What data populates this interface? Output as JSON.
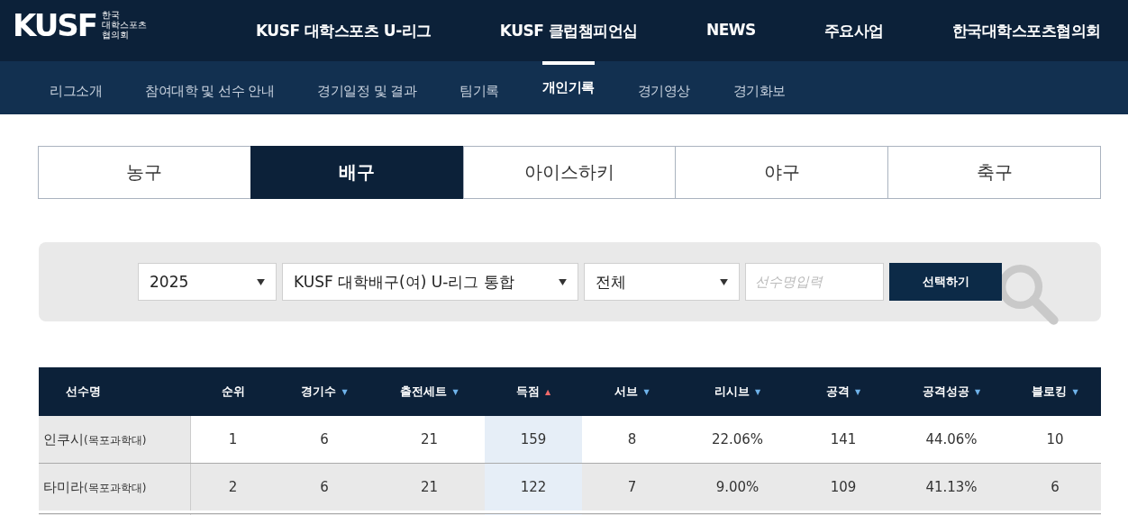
{
  "logo": {
    "mark": "KUSF",
    "lines": [
      "한국",
      "대학스포츠",
      "협의회"
    ]
  },
  "main_nav": [
    "KUSF 대학스포츠 U-리그",
    "KUSF 클럽챔피언십",
    "NEWS",
    "주요사업",
    "한국대학스포츠협의회"
  ],
  "sub_nav": [
    {
      "label": "리그소개",
      "selected": false
    },
    {
      "label": "참여대학 및 선수 안내",
      "selected": false
    },
    {
      "label": "경기일정 및 결과",
      "selected": false
    },
    {
      "label": "팀기록",
      "selected": false
    },
    {
      "label": "개인기록",
      "selected": true
    },
    {
      "label": "경기영상",
      "selected": false
    },
    {
      "label": "경기화보",
      "selected": false
    }
  ],
  "sport_tabs": [
    {
      "label": "농구",
      "selected": false
    },
    {
      "label": "배구",
      "selected": true
    },
    {
      "label": "아이스하키",
      "selected": false
    },
    {
      "label": "야구",
      "selected": false
    },
    {
      "label": "축구",
      "selected": false
    }
  ],
  "filters": {
    "year": "2025",
    "league": "KUSF 대학배구(여) U-리그 통합",
    "group": "전체",
    "search": {
      "placeholder": "선수명입력"
    },
    "button": "선택하기"
  },
  "table": {
    "columns": [
      {
        "label": "선수명"
      },
      {
        "label": "순위"
      },
      {
        "label": "경기수",
        "sorted": false,
        "icon": "▼"
      },
      {
        "label": "출전세트",
        "sorted": false,
        "icon": "▼"
      },
      {
        "label": "득점",
        "sorted": true,
        "icon": "▲"
      },
      {
        "label": "서브",
        "sorted": false,
        "icon": "▼"
      },
      {
        "label": "리시브",
        "sorted": false,
        "icon": "▼"
      },
      {
        "label": "공격",
        "sorted": false,
        "icon": "▼"
      },
      {
        "label": "공격성공",
        "sorted": false,
        "icon": "▼"
      },
      {
        "label": "블로킹",
        "sorted": false,
        "icon": "▼"
      }
    ],
    "rows": [
      {
        "school": "(목포과학대)",
        "cells": [
          "인쿠시",
          "1",
          "6",
          "21",
          "159",
          "8",
          "22.06%",
          "141",
          "44.06%",
          "10"
        ]
      },
      {
        "school": "(목포과학대)",
        "cells": [
          "타미라",
          "2",
          "6",
          "21",
          "122",
          "7",
          "9.00%",
          "109",
          "41.13%",
          "6"
        ]
      }
    ]
  }
}
